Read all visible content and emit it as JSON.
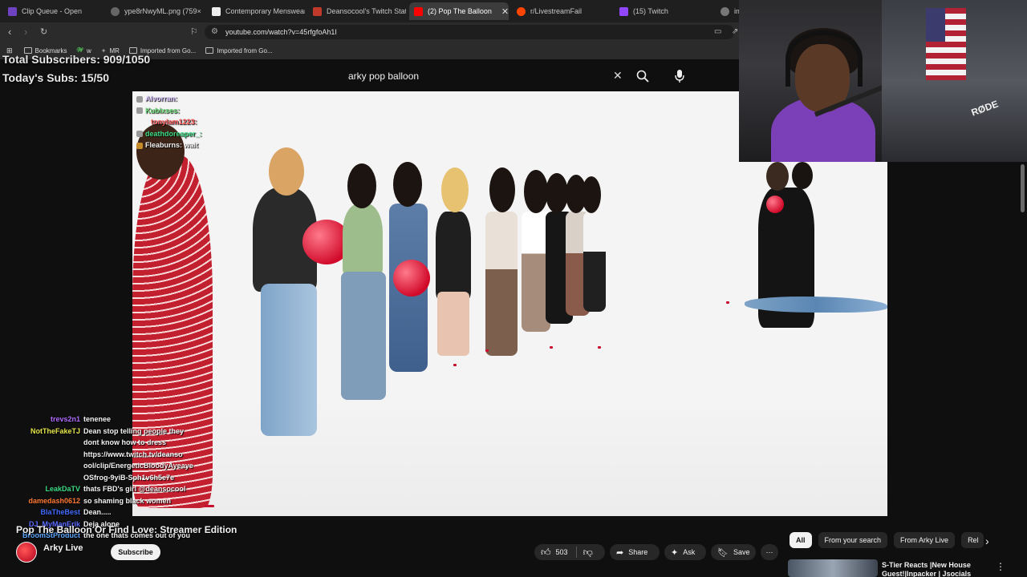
{
  "browser": {
    "tabs": [
      {
        "label": "Clip Queue - Open",
        "color": "#6f42c1"
      },
      {
        "label": "ype8rNwyML.png (759×1",
        "color": "#888888"
      },
      {
        "label": "Contemporary Menswear",
        "color": "#aaaaaa"
      },
      {
        "label": "Deansocool's Twitch Stati",
        "color": "#c0392b"
      },
      {
        "label": "(2) Pop The Balloon",
        "color": "#ff0000",
        "active": true
      },
      {
        "label": "r/LivestreamFail",
        "color": "#ff4500"
      },
      {
        "label": "(15) Twitch",
        "color": "#9146ff"
      },
      {
        "label": "im",
        "color": "#888888"
      }
    ],
    "url": "youtube.com/watch?v=45rfgfoAh1I",
    "bookmarks": [
      "Bookmarks",
      "w",
      "MR",
      "Imported from Go...",
      "Imported from Go..."
    ]
  },
  "overlay": {
    "total_subscribers": "Total Subscribers: 909/1050",
    "today_subs": "Today's Subs: 15/50"
  },
  "youtube": {
    "search_query": "arky pop balloon",
    "video_title": "Pop The Balloon Or Find Love: Streamer Edition",
    "channel_name": "Arky Live",
    "subscribe_label": "Subscribe",
    "likes": "503",
    "share_label": "Share",
    "ask_label": "Ask",
    "save_label": "Save",
    "chips": [
      "All",
      "From your search",
      "From Arky Live",
      "Rel"
    ],
    "rec_title": "S-Tier Reacts |New House Guest!|Inpacker | Jsocials"
  },
  "chat_top": [
    {
      "user": "Alvorran:",
      "color": "#d9c6ff"
    },
    {
      "user": "Kubixses:",
      "color": "#6ee07a"
    },
    {
      "user": "tonylam1223:",
      "color": "#ff5a5a"
    },
    {
      "user": "deathdoreaper_:",
      "color": "#3ddc84"
    },
    {
      "user": "Fleaburns:",
      "msg": "wait",
      "color": "#f2f2f2"
    }
  ],
  "chat_bottom": [
    {
      "user": "trevs2n1",
      "msg": "tenenee",
      "color": "#b06cff"
    },
    {
      "user": "NotTheFakeTJ",
      "msg": "Dean stop telling people they",
      "color": "#e5e54a"
    },
    {
      "user": "",
      "msg": "dont know how to dress"
    },
    {
      "user": "",
      "msg": "https://www.twitch.tv/deanso"
    },
    {
      "user": "",
      "msg": "ool/clip/EnergeticBloodyAyeaye"
    },
    {
      "user": "",
      "msg": "OSfrog-9yiB-Sph1v6h5e7e"
    },
    {
      "user": "LeakDaTV",
      "msg": "thats FBD's girl @deansocool",
      "color": "#3ddc84"
    },
    {
      "user": "damedash0612",
      "msg": "so shaming black women",
      "color": "#ff7a33"
    },
    {
      "user": "BlaTheBest",
      "msg": "Dean.....",
      "color": "#3f6bff"
    },
    {
      "user": "DJ_MyManErik",
      "msg": "Deja alone",
      "color": "#5a6bff"
    },
    {
      "user": "BroomStProduct",
      "msg": "the one thats comes out of you",
      "color": "#5fa8ff"
    }
  ]
}
